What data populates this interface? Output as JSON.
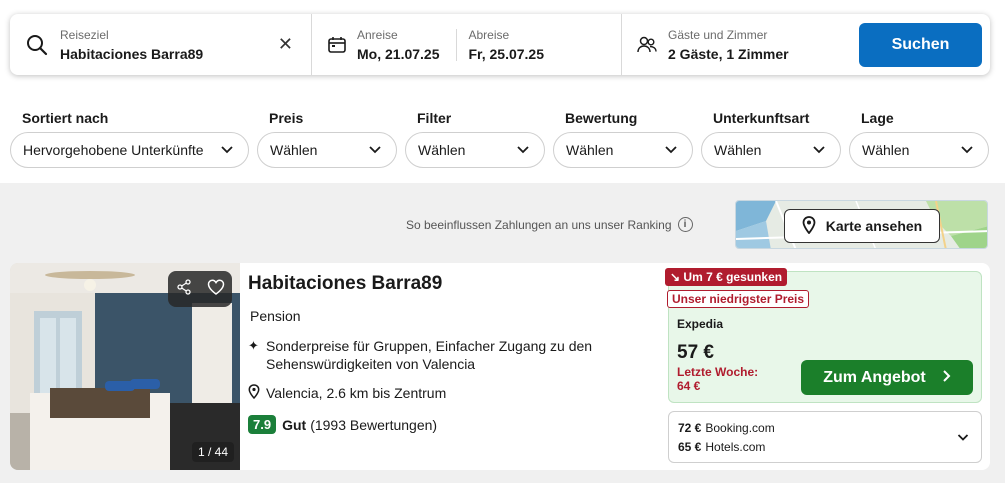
{
  "search": {
    "destination_label": "Reiseziel",
    "destination_value": "Habitaciones Barra89",
    "checkin_label": "Anreise",
    "checkin_value": "Mo, 21.07.25",
    "checkout_label": "Abreise",
    "checkout_value": "Fr, 25.07.25",
    "guests_label": "Gäste und Zimmer",
    "guests_value": "2 Gäste, 1 Zimmer",
    "button_label": "Suchen",
    "clear_icon": "close-icon"
  },
  "filters": [
    {
      "label": "Sortiert nach",
      "value": "Hervorgehobene Unterkünfte"
    },
    {
      "label": "Preis",
      "value": "Wählen"
    },
    {
      "label": "Filter",
      "value": "Wählen"
    },
    {
      "label": "Bewertung",
      "value": "Wählen"
    },
    {
      "label": "Unterkunftsart",
      "value": "Wählen"
    },
    {
      "label": "Lage",
      "value": "Wählen"
    }
  ],
  "ranking_note": "So beeinflussen Zahlungen an uns unser Ranking",
  "map_button": "Karte ansehen",
  "hotel": {
    "name": "Habitaciones Barra89",
    "type": "Pension",
    "feature": "Sonderpreise für Gruppen, Einfacher Zugang zu den Sehenswürdigkeiten von Valencia",
    "location": "Valencia, 2.6 km bis Zentrum",
    "rating_score": "7.9",
    "rating_word": "Gut",
    "rating_count": "(1993 Bewertungen)",
    "photo_counter": "1 / 44"
  },
  "offer": {
    "drop_badge": "Um 7 € gesunken",
    "lowest_badge": "Unser niedrigster Preis",
    "provider": "Expedia",
    "price": "57 €",
    "last_week_label": "Letzte Woche:",
    "last_week_price": "64 €",
    "deal_button": "Zum Angebot",
    "others": [
      {
        "price": "72 €",
        "provider": "Booking.com"
      },
      {
        "price": "65 €",
        "provider": "Hotels.com"
      }
    ]
  },
  "colors": {
    "brand_blue": "#0a6ec1",
    "deal_green": "#1b7f2a",
    "rating_green": "#1b7f3a",
    "price_drop_red": "#b01c2e",
    "price_box_bg": "#e8f7e9"
  }
}
